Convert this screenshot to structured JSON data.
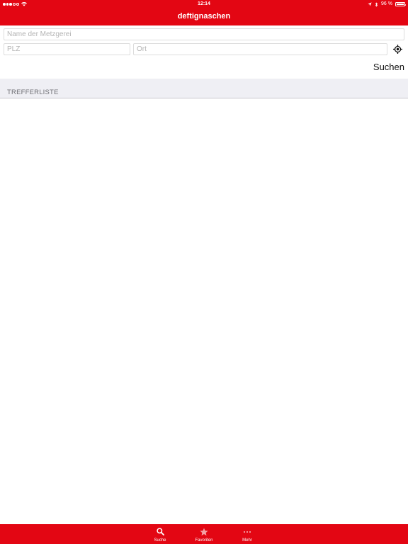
{
  "status_bar": {
    "time": "12:14",
    "battery_text": "96 %",
    "battery_level": 0.96
  },
  "nav": {
    "title": "deftignaschen"
  },
  "search_form": {
    "name_value": "",
    "name_placeholder": "Name der Metzgerei",
    "plz_value": "",
    "plz_placeholder": "PLZ",
    "ort_value": "",
    "ort_placeholder": "Ort",
    "locate_icon": "location-target-icon",
    "search_label": "Suchen"
  },
  "results": {
    "header": "TREFFERLISTE",
    "items": []
  },
  "tab_bar": {
    "tabs": [
      {
        "label": "Suche",
        "icon": "search-icon"
      },
      {
        "label": "Favoriten",
        "icon": "star-icon"
      },
      {
        "label": "Mehr",
        "icon": "more-dots-icon"
      }
    ]
  },
  "colors": {
    "brand_red": "#e30613",
    "section_bg": "#efeff4",
    "white": "#ffffff"
  }
}
